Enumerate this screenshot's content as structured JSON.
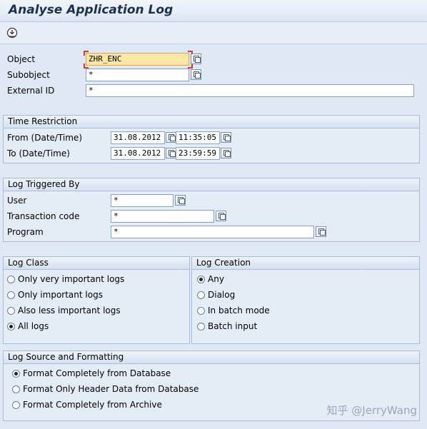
{
  "window": {
    "title": "Analyse Application Log"
  },
  "toolbar": {
    "execute_icon": "execute-icon"
  },
  "selection": {
    "object_label": "Object",
    "object_value": "ZHR_ENC",
    "subobject_label": "Subobject",
    "subobject_value": "*",
    "external_id_label": "External ID",
    "external_id_value": "*"
  },
  "time_restriction": {
    "title": "Time Restriction",
    "from_label": "From (Date/Time)",
    "from_date": "31.08.2012",
    "from_time": "11:35:05",
    "to_label": "To (Date/Time)",
    "to_date": "31.08.2012",
    "to_time": "23:59:59"
  },
  "log_triggered_by": {
    "title": "Log Triggered By",
    "user_label": "User",
    "user_value": "*",
    "tcode_label": "Transaction code",
    "tcode_value": "*",
    "program_label": "Program",
    "program_value": "*"
  },
  "log_class": {
    "title": "Log Class",
    "options": [
      {
        "label": "Only very important logs",
        "selected": false
      },
      {
        "label": "Only important logs",
        "selected": false
      },
      {
        "label": "Also less important logs",
        "selected": false
      },
      {
        "label": "All logs",
        "selected": true
      }
    ]
  },
  "log_creation": {
    "title": "Log Creation",
    "options": [
      {
        "label": "Any",
        "selected": true
      },
      {
        "label": "Dialog",
        "selected": false
      },
      {
        "label": "In batch mode",
        "selected": false
      },
      {
        "label": "Batch input",
        "selected": false
      }
    ]
  },
  "log_source": {
    "title": "Log Source and Formatting",
    "options": [
      {
        "label": "Format Completely from Database",
        "selected": true
      },
      {
        "label": "Format Only Header Data from Database",
        "selected": false
      },
      {
        "label": "Format Completely from Archive",
        "selected": false
      }
    ]
  },
  "watermark": "知乎 @JerryWang",
  "colors": {
    "accent_required": "#fce7a6",
    "group_bg": "#e4ecf6",
    "title": "#1d2f4f"
  }
}
